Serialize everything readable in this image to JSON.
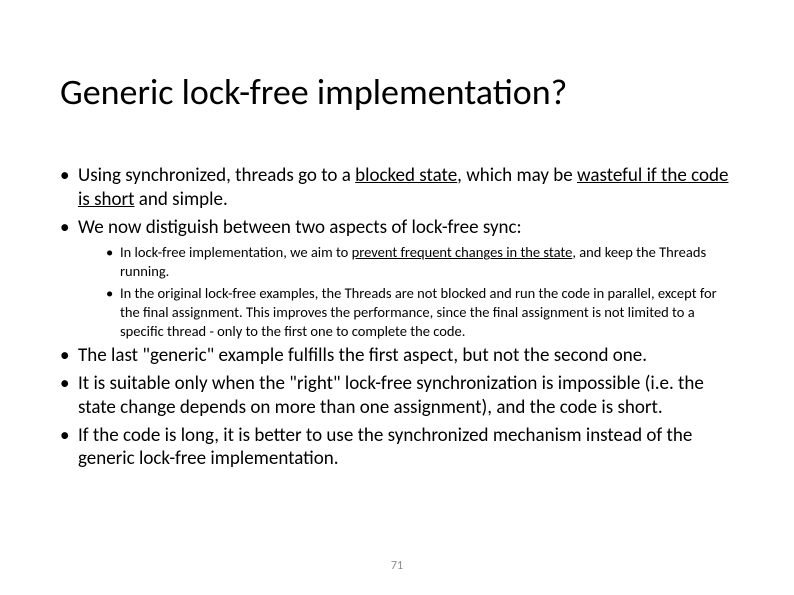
{
  "title": "Generic lock-free implementation?",
  "bullets": {
    "b1_a": "Using synchronized, threads go to a ",
    "b1_u1": "blocked state",
    "b1_b": ", which may be ",
    "b1_u2": "wasteful if the code is short",
    "b1_c": " and simple.",
    "b2": "We now distiguish between two aspects of lock-free sync:",
    "b2_1a": "In lock-free implementation, we aim to ",
    "b2_1u": "prevent frequent changes in the state",
    "b2_1b": ", and keep the Threads running.",
    "b2_2": "In the original lock-free examples, the Threads are not blocked and run the code in parallel, except for the final assignment. This improves the performance, since the final assignment is not limited to a specific thread - only to the first one to complete the code.",
    "b3": "The last \"generic\" example fulfills the first aspect, but not the second one.",
    "b4": "It is suitable only when the \"right\" lock-free synchronization is impossible (i.e. the state change depends on more than one assignment), and the code is short.",
    "b5": "If the code is long, it is better to use the synchronized mechanism instead of the generic lock-free implementation."
  },
  "page_number": "71"
}
